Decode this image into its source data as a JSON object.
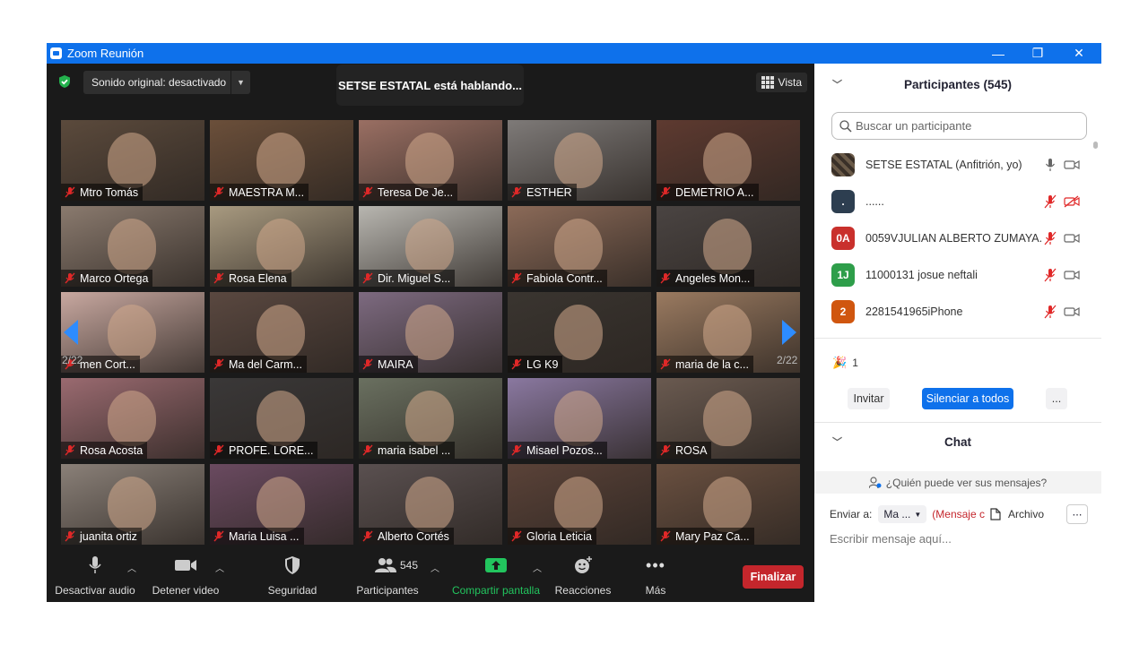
{
  "window": {
    "title": "Zoom Reunión",
    "minimize": "—",
    "restore": "❐",
    "close": "✕"
  },
  "main": {
    "sound": "Sonido original: desactivado",
    "speaking": "SETSE ESTATAL está hablando...",
    "view": "Vista",
    "page_left": "2/22",
    "page_right": "2/22"
  },
  "tiles": [
    {
      "name": "Mtro Tomás",
      "bg": "#5b4a3c"
    },
    {
      "name": "MAESTRA M...",
      "bg": "#6b4f3a"
    },
    {
      "name": "Teresa De Je...",
      "bg": "#9a6f63"
    },
    {
      "name": "ESTHER",
      "bg": "#7e7a78"
    },
    {
      "name": "DEMETRIO A...",
      "bg": "#5e3a30"
    },
    {
      "name": "Marco Ortega",
      "bg": "#8a7a6e"
    },
    {
      "name": "Rosa Elena",
      "bg": "#a89a80"
    },
    {
      "name": "Dir. Miguel S...",
      "bg": "#b8b6b0"
    },
    {
      "name": "Fabiola Contr...",
      "bg": "#8b6a58"
    },
    {
      "name": "Angeles Mon...",
      "bg": "#4a4442"
    },
    {
      "name": "men Cort...",
      "bg": "#c8a8a0"
    },
    {
      "name": "Ma del Carm...",
      "bg": "#5a4840"
    },
    {
      "name": "MAIRA",
      "bg": "#7d6a80"
    },
    {
      "name": "LG K9",
      "bg": "#3a3530"
    },
    {
      "name": "maria de la c...",
      "bg": "#9a7a60"
    },
    {
      "name": "Rosa Acosta",
      "bg": "#9a6a70"
    },
    {
      "name": "PROFE. LORE...",
      "bg": "#3a3838"
    },
    {
      "name": "maria isabel ...",
      "bg": "#6a7060"
    },
    {
      "name": "Misael Pozos...",
      "bg": "#8a78a0"
    },
    {
      "name": "ROSA",
      "bg": "#6a5a50"
    },
    {
      "name": "juanita ortiz",
      "bg": "#8a8078"
    },
    {
      "name": "Maria Luisa ...",
      "bg": "#6a4a60"
    },
    {
      "name": "Alberto Cortés",
      "bg": "#5a5050"
    },
    {
      "name": "Gloria Leticia",
      "bg": "#5a4238"
    },
    {
      "name": "Mary Paz Ca...",
      "bg": "#6a5040"
    }
  ],
  "toolbar": {
    "audio": "Desactivar audio",
    "video": "Detener video",
    "security": "Seguridad",
    "participants": "Participantes",
    "participants_count": "545",
    "share": "Compartir pantalla",
    "reactions": "Reacciones",
    "more": "Más",
    "end": "Finalizar"
  },
  "panel": {
    "title": "Participantes (545)",
    "search_placeholder": "Buscar un participante",
    "participants": [
      {
        "name": "SETSE ESTATAL (Anfitrión, yo)",
        "avatar": "",
        "color": "#6a5a48",
        "muted": false,
        "video_off": false
      },
      {
        "name": "......",
        "avatar": ".",
        "color": "#2d3e50",
        "muted": true,
        "video_off": true
      },
      {
        "name": "0059VJULIAN ALBERTO ZUMAYA...",
        "avatar": "0A",
        "color": "#c9302c",
        "muted": true,
        "video_off": false
      },
      {
        "name": "11000131 josue neftali",
        "avatar": "1J",
        "color": "#2e9e4a",
        "muted": true,
        "video_off": false
      },
      {
        "name": "2281541965iPhone",
        "avatar": "2",
        "color": "#d0560f",
        "muted": true,
        "video_off": false
      }
    ],
    "reaction_count": "1",
    "invite": "Invitar",
    "mute_all": "Silenciar a todos",
    "more": "...",
    "chat_title": "Chat",
    "who_can_see": "¿Quién puede ver sus mensajes?",
    "send_to": "Enviar a:",
    "recipient": "Ma ...",
    "recipient_note": "(Mensaje c",
    "file": "Archivo",
    "message_placeholder": "Escribir mensaje aquí..."
  },
  "colors": {
    "accent": "#0e71eb",
    "end": "#c4262c",
    "share": "#22c55e",
    "muted": "#e02828"
  }
}
